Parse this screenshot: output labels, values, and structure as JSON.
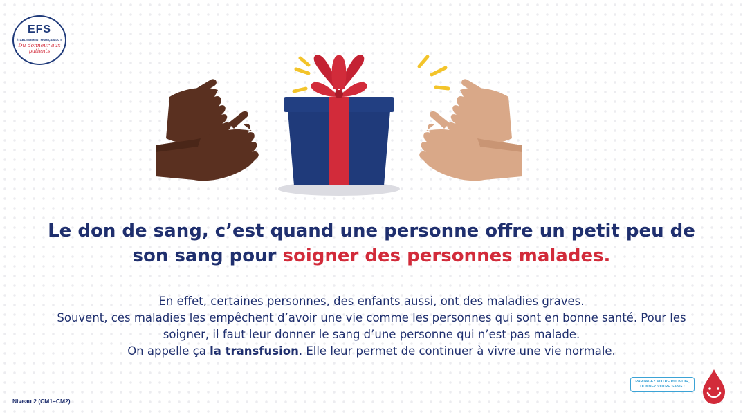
{
  "logo": {
    "brand": "EFS",
    "subtitle": "ÉTABLISSEMENT FRANÇAIS DU SANG",
    "tagline": "Du donneur aux patients"
  },
  "headline": {
    "part1": "Le don de sang, c’est quand une personne offre un petit peu de son sang pour ",
    "highlight": "soigner des personnes malades."
  },
  "body": {
    "line1": "En effet, certaines personnes, des enfants aussi, ont des maladies graves.",
    "line2": "Souvent, ces maladies les empêchent d’avoir une vie comme les personnes qui sont en bonne santé. Pour les soigner, il faut leur donner le sang d’une personne qui n’est pas malade.",
    "line3_prefix": "On appelle ça ",
    "line3_bold": "la transfusion",
    "line3_suffix": ". Elle leur permet de continuer à vivre une vie normale."
  },
  "footer": {
    "level": "Niveau 2 (CM1–CM2)",
    "share_line1": "PARTAGEZ VOTRE POUVOIR,",
    "share_line2": "DONNEZ VOTRE SANG !"
  },
  "colors": {
    "navy": "#1f2f6e",
    "red": "#d22b3a",
    "gift_blue": "#1f3a7a",
    "dark_hand": "#5a3020",
    "light_hand": "#d9a888",
    "spark_yellow": "#f3c42a"
  },
  "icons": {
    "illustration": "gift-exchange-illustration",
    "drop": "blood-drop-icon"
  }
}
